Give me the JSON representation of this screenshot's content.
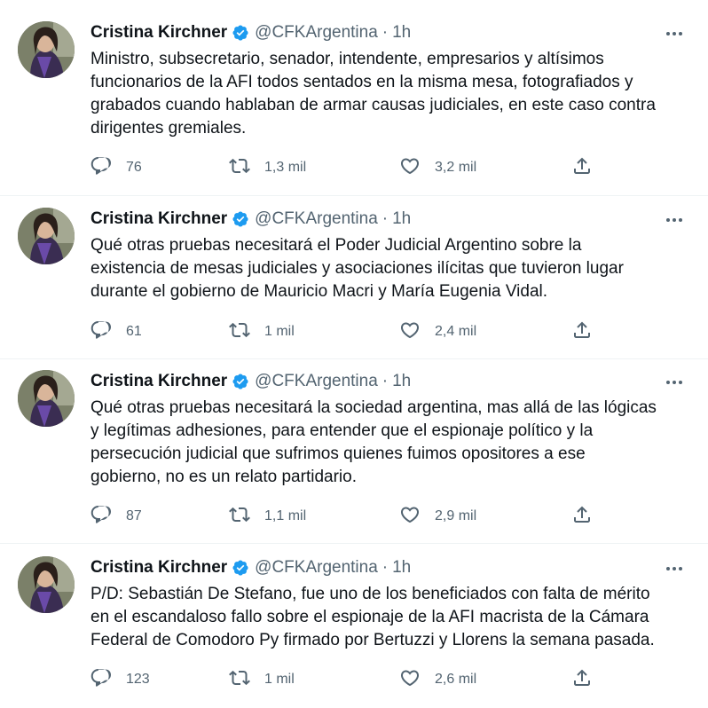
{
  "tweets": [
    {
      "author_name": "Cristina Kirchner",
      "handle": "@CFKArgentina",
      "separator": "·",
      "time": "1h",
      "text": "Ministro, subsecretario, senador, intendente, empresarios y altísimos\nfuncionarios de la AFI todos sentados en la misma mesa, fotografiados y\ngrabados cuando hablaban de armar causas judiciales, en este caso contra\ndirigentes gremiales.",
      "replies": "76",
      "retweets": "1,3 mil",
      "likes": "3,2 mil"
    },
    {
      "author_name": "Cristina Kirchner",
      "handle": "@CFKArgentina",
      "separator": "·",
      "time": "1h",
      "text": "Qué otras pruebas necesitará el Poder Judicial Argentino sobre la\nexistencia de mesas judiciales y asociaciones ilícitas que tuvieron lugar\ndurante el gobierno de Mauricio Macri y María Eugenia Vidal.",
      "replies": "61",
      "retweets": "1 mil",
      "likes": "2,4 mil"
    },
    {
      "author_name": "Cristina Kirchner",
      "handle": "@CFKArgentina",
      "separator": "·",
      "time": "1h",
      "text": "Qué otras pruebas necesitará la sociedad argentina, mas allá de las lógicas\ny legítimas adhesiones, para entender que el espionaje político y la\npersecución judicial que sufrimos quienes fuimos opositores a ese\ngobierno, no es un relato partidario.",
      "replies": "87",
      "retweets": "1,1 mil",
      "likes": "2,9 mil"
    },
    {
      "author_name": "Cristina Kirchner",
      "handle": "@CFKArgentina",
      "separator": "·",
      "time": "1h",
      "text": "P/D: Sebastián De Stefano, fue uno de los beneficiados con falta de mérito\nen el escandaloso fallo sobre el espionaje de la AFI macrista de la Cámara\nFederal de Comodoro Py firmado por Bertuzzi y Llorens la semana pasada.",
      "replies": "123",
      "retweets": "1 mil",
      "likes": "2,6 mil"
    }
  ],
  "icons": {
    "verified": "verified-badge-icon",
    "more": "more-options-icon",
    "reply": "reply-icon",
    "retweet": "retweet-icon",
    "like": "like-icon",
    "share": "share-icon"
  },
  "colors": {
    "verified_blue": "#1d9bf0",
    "muted_text": "#536471",
    "primary_text": "#0f1419"
  }
}
